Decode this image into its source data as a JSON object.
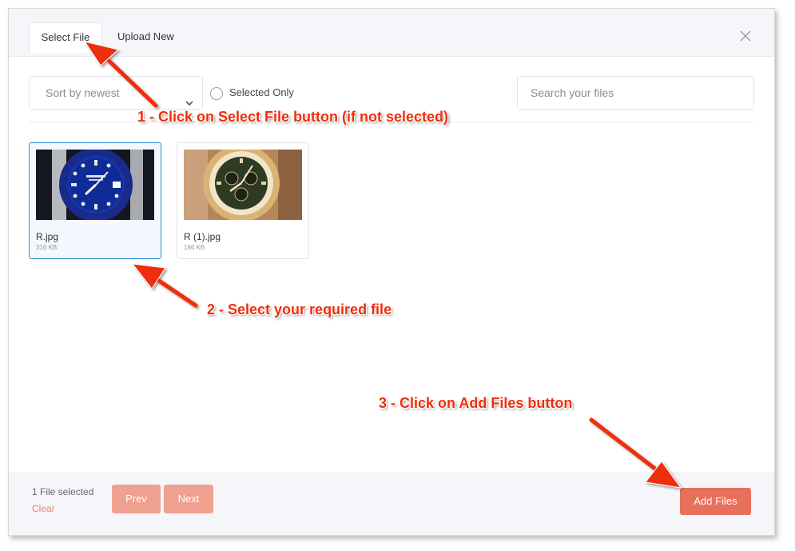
{
  "tabs": {
    "select_file": "Select File",
    "upload_new": "Upload New"
  },
  "toolbar": {
    "sort_value": "Sort by newest",
    "selected_only_label": "Selected Only",
    "search_placeholder": "Search your files"
  },
  "files": [
    {
      "name": "R.jpg",
      "size": "316 KB",
      "selected": true
    },
    {
      "name": "R (1).jpg",
      "size": "186 KB",
      "selected": false
    }
  ],
  "footer": {
    "count_text": "1 File selected",
    "clear_label": "Clear",
    "prev_label": "Prev",
    "next_label": "Next",
    "add_label": "Add Files"
  },
  "annotations": {
    "step1": "1 - Click on Select File button (if not selected)",
    "step2": "2 - Select your required file",
    "step3": "3 - Click on Add Files button"
  },
  "colors": {
    "accent": "#e8705b",
    "accent_light": "#f0a08f",
    "selected_border": "#2d8fd5",
    "annotation_red": "#ef2d0a"
  },
  "icons": [
    "close-icon",
    "chevron-down-icon",
    "radio-icon",
    "arrow-icon"
  ]
}
